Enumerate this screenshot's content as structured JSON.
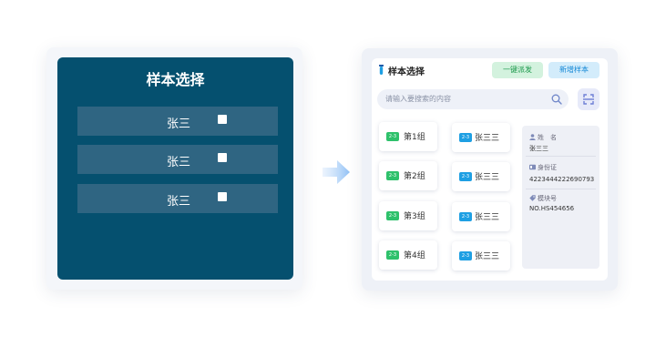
{
  "left_panel": {
    "title": "样本选择",
    "rows": [
      {
        "name": "张三",
        "checked": false
      },
      {
        "name": "张三",
        "checked": false
      },
      {
        "name": "张三",
        "checked": false
      }
    ]
  },
  "right_panel": {
    "title": "样本选择",
    "btn_dispatch": "一键派发",
    "btn_add": "新增样本",
    "search_placeholder": "请输入要搜索的内容",
    "groups": [
      "第1组",
      "第2组",
      "第3组",
      "第4组"
    ],
    "members": [
      "张三三",
      "张三三",
      "张三三",
      "张三三"
    ],
    "tag_text": "2-3",
    "info": {
      "name_label": "姓　名",
      "name_value": "张三三",
      "id_label": "身份证",
      "id_value": "4223444222690793",
      "module_label": "模块号",
      "module_value": "NO.HS454656"
    },
    "colors": {
      "green": "#2ec16b",
      "blue": "#1e9fe3",
      "navy": "#05506f"
    }
  }
}
